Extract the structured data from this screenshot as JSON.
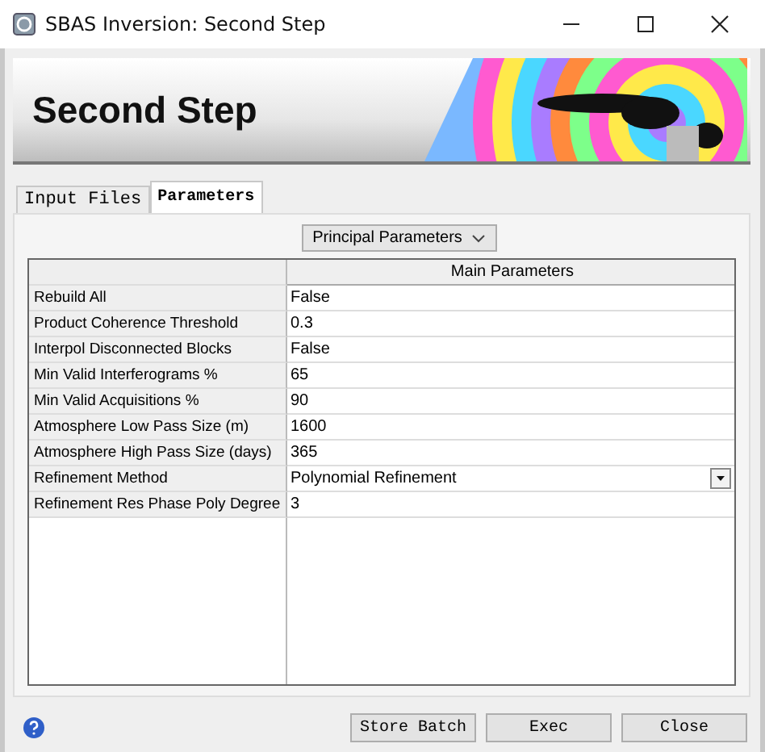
{
  "window": {
    "title": "SBAS Inversion: Second Step"
  },
  "header": {
    "title": "Second Step",
    "kind": "picture"
  },
  "tabs": [
    {
      "label": "Input Files",
      "selected": false
    },
    {
      "label": "Parameters",
      "selected": true
    }
  ],
  "section_dropdown": {
    "value": "Principal Parameters"
  },
  "table": {
    "columns": [
      "Main Parameters"
    ],
    "rows": [
      {
        "name": "Rebuild All",
        "value": "False",
        "kind": "text"
      },
      {
        "name": "Product Coherence Threshold",
        "value": "0.3",
        "kind": "text"
      },
      {
        "name": "Interpol Disconnected Blocks",
        "value": "False",
        "kind": "text"
      },
      {
        "name": "Min Valid Interferograms %",
        "value": "65",
        "kind": "text"
      },
      {
        "name": "Min Valid Acquisitions %",
        "value": "90",
        "kind": "text"
      },
      {
        "name": "Atmosphere Low Pass Size (m)",
        "value": "1600",
        "kind": "text"
      },
      {
        "name": "Atmosphere High Pass Size (days)",
        "value": "365",
        "kind": "text"
      },
      {
        "name": "Refinement Method",
        "value": "Polynomial Refinement",
        "kind": "dropdown"
      },
      {
        "name": "Refinement Res Phase Poly Degree",
        "value": "3",
        "kind": "text"
      }
    ]
  },
  "buttons": [
    "Store Batch",
    "Exec",
    "Close"
  ]
}
